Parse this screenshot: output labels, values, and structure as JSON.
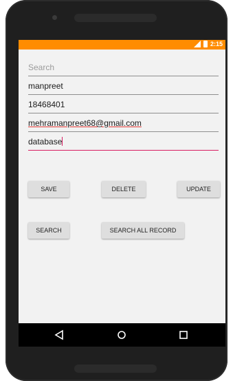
{
  "status_bar": {
    "time": "2:15",
    "accent": "#ff8c00",
    "icons": [
      "signal-icon",
      "battery-icon"
    ]
  },
  "form": {
    "search_placeholder": "Search",
    "name_value": "manpreet",
    "id_value": "18468401",
    "email_value": "mehramanpreet68@gmail.com",
    "subject_value": "database"
  },
  "buttons": {
    "save": "SAVE",
    "delete": "DELETE",
    "update": "UPDATE",
    "search": "SEARCH",
    "search_all": "SEARCH ALL RECORD"
  },
  "nav": {
    "icons": [
      "back-icon",
      "home-icon",
      "recents-icon"
    ]
  }
}
